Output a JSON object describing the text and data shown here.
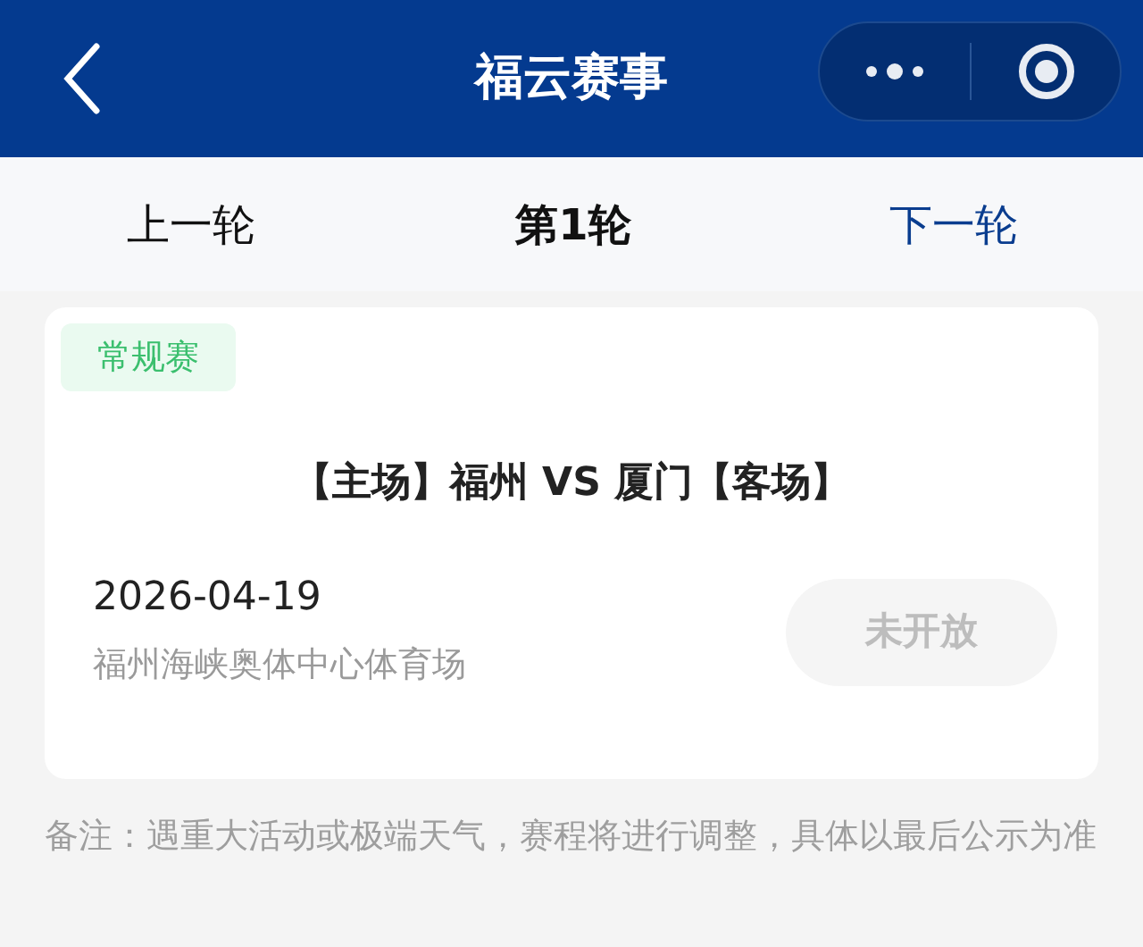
{
  "header": {
    "title": "福云赛事"
  },
  "round_nav": {
    "previous": "上一轮",
    "current": "第1轮",
    "next": "下一轮"
  },
  "match": {
    "tag": "常规赛",
    "title": "【主场】福州 VS 厦门【客场】",
    "date": "2026-04-19",
    "venue": "福州海峡奥体中心体育场",
    "button": {
      "label": "未开放",
      "disabled": true
    }
  },
  "note": "备注：遇重大活动或极端天气，赛程将进行调整，具体以最后公示为准"
}
